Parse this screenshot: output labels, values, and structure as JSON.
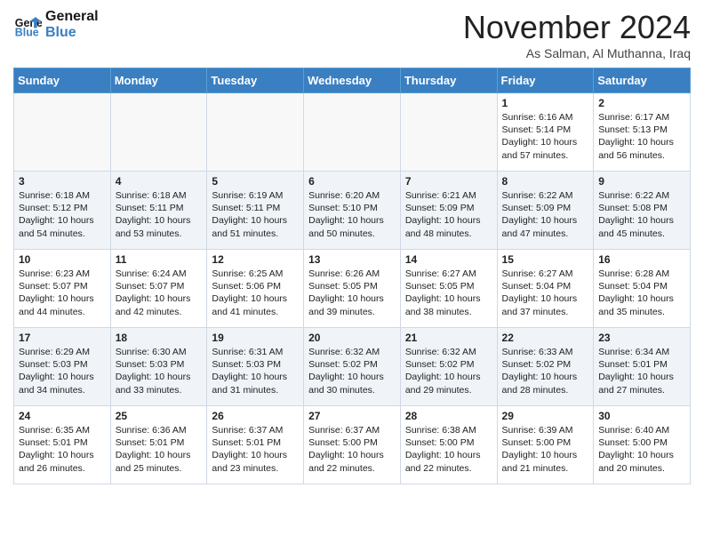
{
  "header": {
    "logo_line1": "General",
    "logo_line2": "Blue",
    "month": "November 2024",
    "location": "As Salman, Al Muthanna, Iraq"
  },
  "days_of_week": [
    "Sunday",
    "Monday",
    "Tuesday",
    "Wednesday",
    "Thursday",
    "Friday",
    "Saturday"
  ],
  "weeks": [
    [
      {
        "day": "",
        "content": ""
      },
      {
        "day": "",
        "content": ""
      },
      {
        "day": "",
        "content": ""
      },
      {
        "day": "",
        "content": ""
      },
      {
        "day": "",
        "content": ""
      },
      {
        "day": "1",
        "content": "Sunrise: 6:16 AM\nSunset: 5:14 PM\nDaylight: 10 hours and 57 minutes."
      },
      {
        "day": "2",
        "content": "Sunrise: 6:17 AM\nSunset: 5:13 PM\nDaylight: 10 hours and 56 minutes."
      }
    ],
    [
      {
        "day": "3",
        "content": "Sunrise: 6:18 AM\nSunset: 5:12 PM\nDaylight: 10 hours and 54 minutes."
      },
      {
        "day": "4",
        "content": "Sunrise: 6:18 AM\nSunset: 5:11 PM\nDaylight: 10 hours and 53 minutes."
      },
      {
        "day": "5",
        "content": "Sunrise: 6:19 AM\nSunset: 5:11 PM\nDaylight: 10 hours and 51 minutes."
      },
      {
        "day": "6",
        "content": "Sunrise: 6:20 AM\nSunset: 5:10 PM\nDaylight: 10 hours and 50 minutes."
      },
      {
        "day": "7",
        "content": "Sunrise: 6:21 AM\nSunset: 5:09 PM\nDaylight: 10 hours and 48 minutes."
      },
      {
        "day": "8",
        "content": "Sunrise: 6:22 AM\nSunset: 5:09 PM\nDaylight: 10 hours and 47 minutes."
      },
      {
        "day": "9",
        "content": "Sunrise: 6:22 AM\nSunset: 5:08 PM\nDaylight: 10 hours and 45 minutes."
      }
    ],
    [
      {
        "day": "10",
        "content": "Sunrise: 6:23 AM\nSunset: 5:07 PM\nDaylight: 10 hours and 44 minutes."
      },
      {
        "day": "11",
        "content": "Sunrise: 6:24 AM\nSunset: 5:07 PM\nDaylight: 10 hours and 42 minutes."
      },
      {
        "day": "12",
        "content": "Sunrise: 6:25 AM\nSunset: 5:06 PM\nDaylight: 10 hours and 41 minutes."
      },
      {
        "day": "13",
        "content": "Sunrise: 6:26 AM\nSunset: 5:05 PM\nDaylight: 10 hours and 39 minutes."
      },
      {
        "day": "14",
        "content": "Sunrise: 6:27 AM\nSunset: 5:05 PM\nDaylight: 10 hours and 38 minutes."
      },
      {
        "day": "15",
        "content": "Sunrise: 6:27 AM\nSunset: 5:04 PM\nDaylight: 10 hours and 37 minutes."
      },
      {
        "day": "16",
        "content": "Sunrise: 6:28 AM\nSunset: 5:04 PM\nDaylight: 10 hours and 35 minutes."
      }
    ],
    [
      {
        "day": "17",
        "content": "Sunrise: 6:29 AM\nSunset: 5:03 PM\nDaylight: 10 hours and 34 minutes."
      },
      {
        "day": "18",
        "content": "Sunrise: 6:30 AM\nSunset: 5:03 PM\nDaylight: 10 hours and 33 minutes."
      },
      {
        "day": "19",
        "content": "Sunrise: 6:31 AM\nSunset: 5:03 PM\nDaylight: 10 hours and 31 minutes."
      },
      {
        "day": "20",
        "content": "Sunrise: 6:32 AM\nSunset: 5:02 PM\nDaylight: 10 hours and 30 minutes."
      },
      {
        "day": "21",
        "content": "Sunrise: 6:32 AM\nSunset: 5:02 PM\nDaylight: 10 hours and 29 minutes."
      },
      {
        "day": "22",
        "content": "Sunrise: 6:33 AM\nSunset: 5:02 PM\nDaylight: 10 hours and 28 minutes."
      },
      {
        "day": "23",
        "content": "Sunrise: 6:34 AM\nSunset: 5:01 PM\nDaylight: 10 hours and 27 minutes."
      }
    ],
    [
      {
        "day": "24",
        "content": "Sunrise: 6:35 AM\nSunset: 5:01 PM\nDaylight: 10 hours and 26 minutes."
      },
      {
        "day": "25",
        "content": "Sunrise: 6:36 AM\nSunset: 5:01 PM\nDaylight: 10 hours and 25 minutes."
      },
      {
        "day": "26",
        "content": "Sunrise: 6:37 AM\nSunset: 5:01 PM\nDaylight: 10 hours and 23 minutes."
      },
      {
        "day": "27",
        "content": "Sunrise: 6:37 AM\nSunset: 5:00 PM\nDaylight: 10 hours and 22 minutes."
      },
      {
        "day": "28",
        "content": "Sunrise: 6:38 AM\nSunset: 5:00 PM\nDaylight: 10 hours and 22 minutes."
      },
      {
        "day": "29",
        "content": "Sunrise: 6:39 AM\nSunset: 5:00 PM\nDaylight: 10 hours and 21 minutes."
      },
      {
        "day": "30",
        "content": "Sunrise: 6:40 AM\nSunset: 5:00 PM\nDaylight: 10 hours and 20 minutes."
      }
    ]
  ]
}
